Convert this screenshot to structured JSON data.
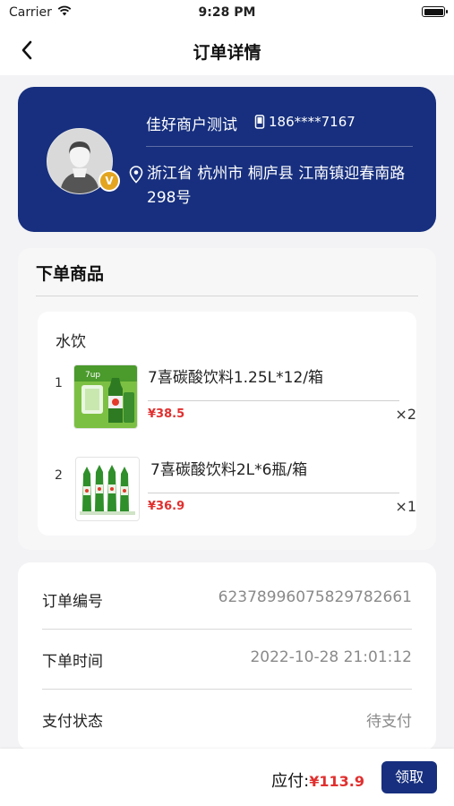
{
  "status_bar": {
    "carrier": "Carrier",
    "time": "9:28 PM",
    "battery_level": 1.0
  },
  "nav": {
    "title": "订单详情"
  },
  "address": {
    "shop_name": "佳好商户测试",
    "phone": "186****7167",
    "address": "浙江省 杭州市 桐庐县 江南镇迎春南路298号",
    "badge": "V"
  },
  "goods": {
    "title": "下单商品",
    "category": "水饮",
    "items": [
      {
        "index": "1",
        "name": "7喜碳酸饮料1.25L*12/箱",
        "price": "¥38.5",
        "qty": "×2"
      },
      {
        "index": "2",
        "name": "7喜碳酸饮料2L*6瓶/箱",
        "price": "¥36.9",
        "qty": "×1"
      }
    ]
  },
  "info": {
    "rows": [
      {
        "label": "订单编号",
        "value": "6237899607582978266​1"
      },
      {
        "label": "下单时间",
        "value": "2022-10-28 21:01:12"
      },
      {
        "label": "支付状态",
        "value": "待支付"
      }
    ]
  },
  "bottom": {
    "pay_label": "应付:",
    "pay_amount": "¥113.9",
    "button": "领取"
  },
  "colors": {
    "primary": "#172f7e",
    "price": "#e0302f",
    "badge": "#e3a520"
  }
}
